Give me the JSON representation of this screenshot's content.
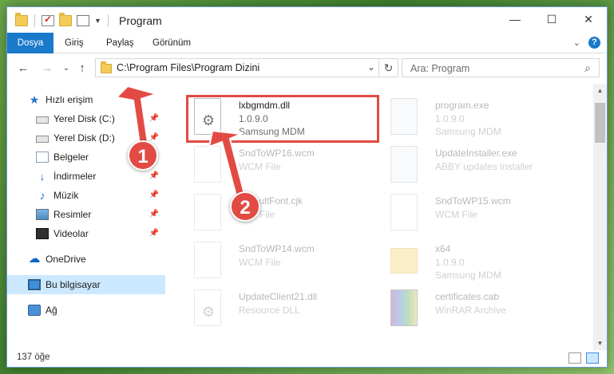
{
  "window": {
    "title": "Program"
  },
  "window_controls": {
    "minimize": "—",
    "maximize": "☐",
    "close": "✕"
  },
  "ribbon": {
    "tabs": [
      {
        "label": "Dosya",
        "active": true
      },
      {
        "label": "Giriş"
      },
      {
        "label": "Paylaş"
      },
      {
        "label": "Görünüm"
      }
    ]
  },
  "address": {
    "path": "C:\\Program Files\\Program Dizini"
  },
  "search": {
    "placeholder": "Ara: Program"
  },
  "sidebar": {
    "items": [
      {
        "label": "Hızlı erişim",
        "icon": "star-icon"
      },
      {
        "label": "Yerel Disk (C:)",
        "icon": "drive-icon",
        "pinned": true
      },
      {
        "label": "Yerel Disk (D:)",
        "icon": "drive-icon",
        "pinned": true
      },
      {
        "label": "Belgeler",
        "icon": "documents-icon",
        "pinned": true
      },
      {
        "label": "İndirmeler",
        "icon": "download-icon",
        "pinned": true
      },
      {
        "label": "Müzik",
        "icon": "music-icon",
        "pinned": true
      },
      {
        "label": "Resimler",
        "icon": "pictures-icon",
        "pinned": true
      },
      {
        "label": "Videolar",
        "icon": "videos-icon",
        "pinned": true
      },
      {
        "label": "OneDrive",
        "icon": "onedrive-icon"
      },
      {
        "label": "Bu bilgisayar",
        "icon": "pc-icon",
        "selected": true
      },
      {
        "label": "Ağ",
        "icon": "network-icon"
      }
    ]
  },
  "files": [
    {
      "name": "lxbgmdm.dll",
      "meta1": "1.0.9.0",
      "meta2": "Samsung MDM",
      "icon": "dll-gear-icon",
      "highlighted": true
    },
    {
      "name": "program.exe",
      "meta1": "1.0.9.0",
      "meta2": "Samsung MDM",
      "icon": "exe-icon"
    },
    {
      "name": "SndToWP16.wcm",
      "meta1": "WCM File",
      "meta2": "",
      "icon": "file-icon"
    },
    {
      "name": "UpdateInstaller.exe",
      "meta1": "ABBY updates installer",
      "meta2": "",
      "icon": "installer-icon"
    },
    {
      "name": "DefaultFont.cjk",
      "meta1": "CJK File",
      "meta2": "",
      "icon": "file-icon"
    },
    {
      "name": "SndToWP15.wcm",
      "meta1": "WCM File",
      "meta2": "",
      "icon": "file-icon"
    },
    {
      "name": "SndToWP14.wcm",
      "meta1": "WCM File",
      "meta2": "",
      "icon": "file-icon"
    },
    {
      "name": "x64",
      "meta1": "1.0.9.0",
      "meta2": "Samsung MDM",
      "icon": "folder-icon"
    },
    {
      "name": "UpdateClient21.dll",
      "meta1": "Resource DLL",
      "meta2": "",
      "icon": "dll-gear-icon"
    },
    {
      "name": "certificates.cab",
      "meta1": "WinRAR Archive",
      "meta2": "",
      "icon": "winrar-icon"
    }
  ],
  "status": {
    "count": "137 öğe"
  },
  "annotations": {
    "step1": "1",
    "step2": "2"
  },
  "colors": {
    "accent": "#1979ca",
    "annotation": "#e24b44",
    "selected": "#cce8ff"
  }
}
